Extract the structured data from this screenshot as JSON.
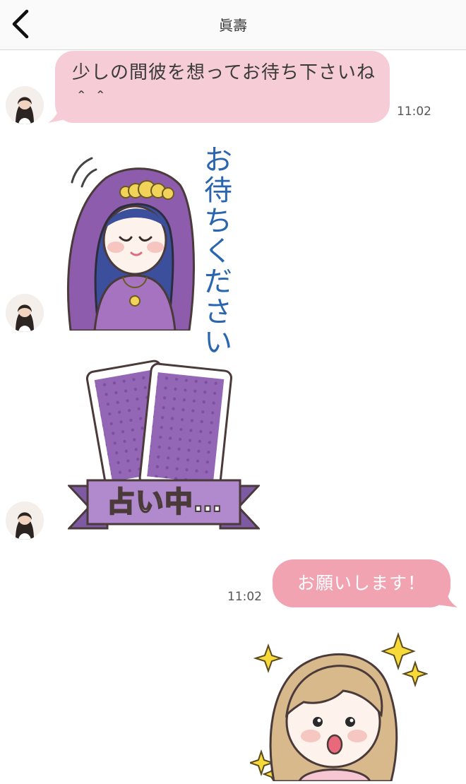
{
  "header": {
    "title": "眞壽"
  },
  "messages": {
    "incoming_text": "少しの間彼を想ってお待ち下さいね＾＾",
    "incoming_time": "11:02",
    "sticker_wait_caption": [
      "お",
      "待",
      "ち",
      "く",
      "だ",
      "さ",
      "い"
    ],
    "sticker_reading_caption": "占い中…",
    "outgoing_text": "お願いします！",
    "outgoing_time": "11:02"
  },
  "colors": {
    "incoming_bubble": "#f6cdd6",
    "outgoing_bubble": "#f2a3b2",
    "purple": "#8a5aa8",
    "caption_blue": "#2a66b0"
  },
  "icons": {
    "back": "chevron-left-icon"
  }
}
